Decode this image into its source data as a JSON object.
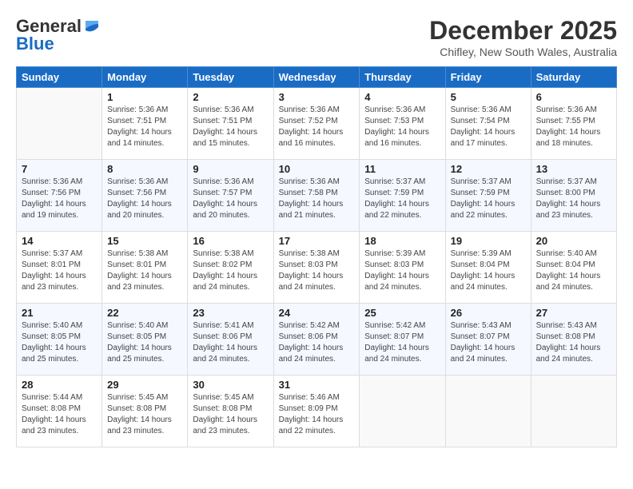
{
  "logo": {
    "general": "General",
    "blue": "Blue"
  },
  "title": {
    "month": "December 2025",
    "location": "Chifley, New South Wales, Australia"
  },
  "weekdays": [
    "Sunday",
    "Monday",
    "Tuesday",
    "Wednesday",
    "Thursday",
    "Friday",
    "Saturday"
  ],
  "weeks": [
    [
      {
        "day": "",
        "sunrise": "",
        "sunset": "",
        "daylight": ""
      },
      {
        "day": "1",
        "sunrise": "Sunrise: 5:36 AM",
        "sunset": "Sunset: 7:51 PM",
        "daylight": "Daylight: 14 hours and 14 minutes."
      },
      {
        "day": "2",
        "sunrise": "Sunrise: 5:36 AM",
        "sunset": "Sunset: 7:51 PM",
        "daylight": "Daylight: 14 hours and 15 minutes."
      },
      {
        "day": "3",
        "sunrise": "Sunrise: 5:36 AM",
        "sunset": "Sunset: 7:52 PM",
        "daylight": "Daylight: 14 hours and 16 minutes."
      },
      {
        "day": "4",
        "sunrise": "Sunrise: 5:36 AM",
        "sunset": "Sunset: 7:53 PM",
        "daylight": "Daylight: 14 hours and 16 minutes."
      },
      {
        "day": "5",
        "sunrise": "Sunrise: 5:36 AM",
        "sunset": "Sunset: 7:54 PM",
        "daylight": "Daylight: 14 hours and 17 minutes."
      },
      {
        "day": "6",
        "sunrise": "Sunrise: 5:36 AM",
        "sunset": "Sunset: 7:55 PM",
        "daylight": "Daylight: 14 hours and 18 minutes."
      }
    ],
    [
      {
        "day": "7",
        "sunrise": "Sunrise: 5:36 AM",
        "sunset": "Sunset: 7:56 PM",
        "daylight": "Daylight: 14 hours and 19 minutes."
      },
      {
        "day": "8",
        "sunrise": "Sunrise: 5:36 AM",
        "sunset": "Sunset: 7:56 PM",
        "daylight": "Daylight: 14 hours and 20 minutes."
      },
      {
        "day": "9",
        "sunrise": "Sunrise: 5:36 AM",
        "sunset": "Sunset: 7:57 PM",
        "daylight": "Daylight: 14 hours and 20 minutes."
      },
      {
        "day": "10",
        "sunrise": "Sunrise: 5:36 AM",
        "sunset": "Sunset: 7:58 PM",
        "daylight": "Daylight: 14 hours and 21 minutes."
      },
      {
        "day": "11",
        "sunrise": "Sunrise: 5:37 AM",
        "sunset": "Sunset: 7:59 PM",
        "daylight": "Daylight: 14 hours and 22 minutes."
      },
      {
        "day": "12",
        "sunrise": "Sunrise: 5:37 AM",
        "sunset": "Sunset: 7:59 PM",
        "daylight": "Daylight: 14 hours and 22 minutes."
      },
      {
        "day": "13",
        "sunrise": "Sunrise: 5:37 AM",
        "sunset": "Sunset: 8:00 PM",
        "daylight": "Daylight: 14 hours and 23 minutes."
      }
    ],
    [
      {
        "day": "14",
        "sunrise": "Sunrise: 5:37 AM",
        "sunset": "Sunset: 8:01 PM",
        "daylight": "Daylight: 14 hours and 23 minutes."
      },
      {
        "day": "15",
        "sunrise": "Sunrise: 5:38 AM",
        "sunset": "Sunset: 8:01 PM",
        "daylight": "Daylight: 14 hours and 23 minutes."
      },
      {
        "day": "16",
        "sunrise": "Sunrise: 5:38 AM",
        "sunset": "Sunset: 8:02 PM",
        "daylight": "Daylight: 14 hours and 24 minutes."
      },
      {
        "day": "17",
        "sunrise": "Sunrise: 5:38 AM",
        "sunset": "Sunset: 8:03 PM",
        "daylight": "Daylight: 14 hours and 24 minutes."
      },
      {
        "day": "18",
        "sunrise": "Sunrise: 5:39 AM",
        "sunset": "Sunset: 8:03 PM",
        "daylight": "Daylight: 14 hours and 24 minutes."
      },
      {
        "day": "19",
        "sunrise": "Sunrise: 5:39 AM",
        "sunset": "Sunset: 8:04 PM",
        "daylight": "Daylight: 14 hours and 24 minutes."
      },
      {
        "day": "20",
        "sunrise": "Sunrise: 5:40 AM",
        "sunset": "Sunset: 8:04 PM",
        "daylight": "Daylight: 14 hours and 24 minutes."
      }
    ],
    [
      {
        "day": "21",
        "sunrise": "Sunrise: 5:40 AM",
        "sunset": "Sunset: 8:05 PM",
        "daylight": "Daylight: 14 hours and 25 minutes."
      },
      {
        "day": "22",
        "sunrise": "Sunrise: 5:40 AM",
        "sunset": "Sunset: 8:05 PM",
        "daylight": "Daylight: 14 hours and 25 minutes."
      },
      {
        "day": "23",
        "sunrise": "Sunrise: 5:41 AM",
        "sunset": "Sunset: 8:06 PM",
        "daylight": "Daylight: 14 hours and 24 minutes."
      },
      {
        "day": "24",
        "sunrise": "Sunrise: 5:42 AM",
        "sunset": "Sunset: 8:06 PM",
        "daylight": "Daylight: 14 hours and 24 minutes."
      },
      {
        "day": "25",
        "sunrise": "Sunrise: 5:42 AM",
        "sunset": "Sunset: 8:07 PM",
        "daylight": "Daylight: 14 hours and 24 minutes."
      },
      {
        "day": "26",
        "sunrise": "Sunrise: 5:43 AM",
        "sunset": "Sunset: 8:07 PM",
        "daylight": "Daylight: 14 hours and 24 minutes."
      },
      {
        "day": "27",
        "sunrise": "Sunrise: 5:43 AM",
        "sunset": "Sunset: 8:08 PM",
        "daylight": "Daylight: 14 hours and 24 minutes."
      }
    ],
    [
      {
        "day": "28",
        "sunrise": "Sunrise: 5:44 AM",
        "sunset": "Sunset: 8:08 PM",
        "daylight": "Daylight: 14 hours and 23 minutes."
      },
      {
        "day": "29",
        "sunrise": "Sunrise: 5:45 AM",
        "sunset": "Sunset: 8:08 PM",
        "daylight": "Daylight: 14 hours and 23 minutes."
      },
      {
        "day": "30",
        "sunrise": "Sunrise: 5:45 AM",
        "sunset": "Sunset: 8:08 PM",
        "daylight": "Daylight: 14 hours and 23 minutes."
      },
      {
        "day": "31",
        "sunrise": "Sunrise: 5:46 AM",
        "sunset": "Sunset: 8:09 PM",
        "daylight": "Daylight: 14 hours and 22 minutes."
      },
      {
        "day": "",
        "sunrise": "",
        "sunset": "",
        "daylight": ""
      },
      {
        "day": "",
        "sunrise": "",
        "sunset": "",
        "daylight": ""
      },
      {
        "day": "",
        "sunrise": "",
        "sunset": "",
        "daylight": ""
      }
    ]
  ]
}
